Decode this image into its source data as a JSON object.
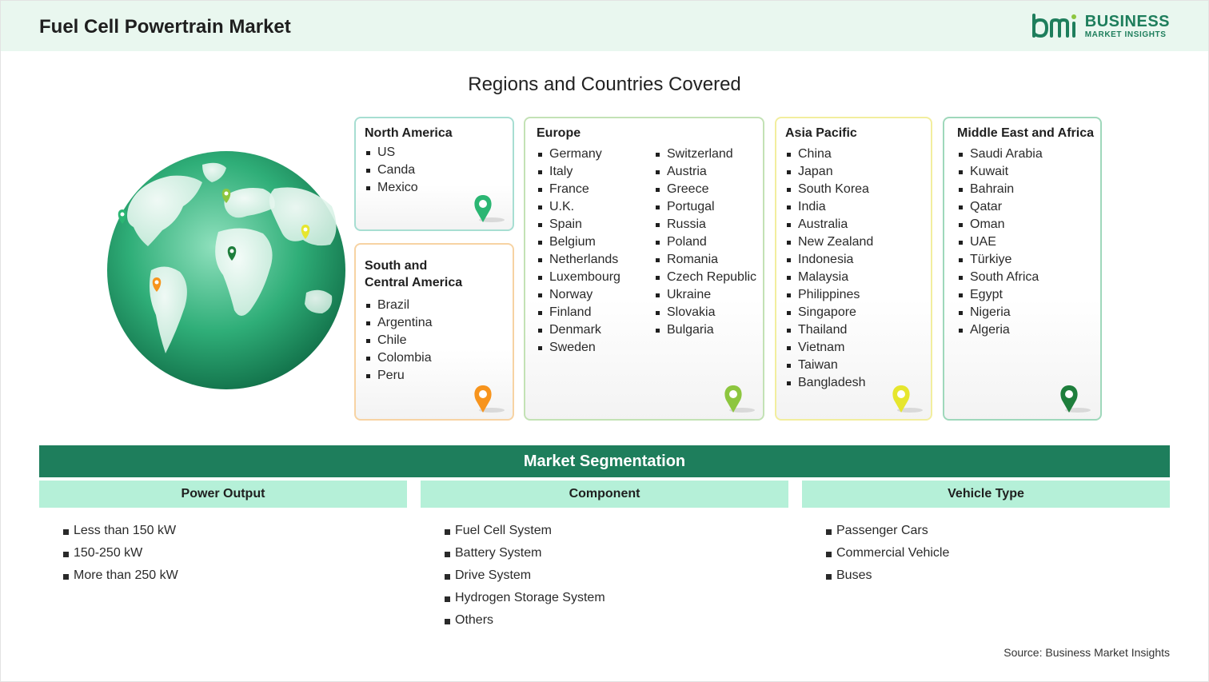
{
  "header": {
    "title": "Fuel Cell Powertrain Market",
    "logo_line1": "BUSINESS",
    "logo_line2": "MARKET INSIGHTS",
    "logo_mark": "bmi",
    "brand_color": "#1e7e5c"
  },
  "regions": {
    "title": "Regions and Countries Covered",
    "north_america": {
      "name": "North America",
      "countries": [
        "US",
        "Canda",
        "Mexico"
      ],
      "pin_color": "#2bb673"
    },
    "south_central_america": {
      "name_line1": "South and",
      "name_line2": "Central America",
      "countries": [
        "Brazil",
        "Argentina",
        "Chile",
        "Colombia",
        "Peru"
      ],
      "pin_color": "#f7941d"
    },
    "europe": {
      "name": "Europe",
      "col1": [
        "Germany",
        "Italy",
        "France",
        "U.K.",
        "Spain",
        "Belgium",
        "Netherlands",
        "Luxembourg",
        "Norway",
        "Finland",
        "Denmark",
        "Sweden"
      ],
      "col2": [
        "Switzerland",
        "Austria",
        "Greece",
        "Portugal",
        "Russia",
        "Poland",
        "Romania",
        "Czech Republic",
        "Ukraine",
        "Slovakia",
        "Bulgaria"
      ],
      "pin_color": "#8dc63f"
    },
    "asia_pacific": {
      "name": "Asia Pacific",
      "countries": [
        "China",
        "Japan",
        "South Korea",
        "India",
        "Australia",
        "New Zealand",
        "Indonesia",
        "Malaysia",
        "Philippines",
        "Singapore",
        "Thailand",
        "Vietnam",
        "Taiwan",
        "Bangladesh"
      ],
      "pin_color": "#e6e62e"
    },
    "middle_east_africa": {
      "name": "Middle East and Africa",
      "countries": [
        "Saudi Arabia",
        "Kuwait",
        "Bahrain",
        "Qatar",
        "Oman",
        "UAE",
        "Türkiye",
        "South Africa",
        "Egypt",
        "Nigeria",
        "Algeria"
      ],
      "pin_color": "#1e7e3c"
    }
  },
  "segmentation": {
    "title": "Market Segmentation",
    "power_output": {
      "label": "Power Output",
      "items": [
        "Less than 150 kW",
        "150-250 kW",
        "More than 250 kW"
      ]
    },
    "component": {
      "label": "Component",
      "items": [
        "Fuel Cell System",
        "Battery System",
        "Drive System",
        "Hydrogen Storage System",
        "Others"
      ]
    },
    "vehicle_type": {
      "label": "Vehicle Type",
      "items": [
        "Passenger Cars",
        "Commercial Vehicle",
        "Buses"
      ]
    }
  },
  "source": "Source: Business Market Insights"
}
